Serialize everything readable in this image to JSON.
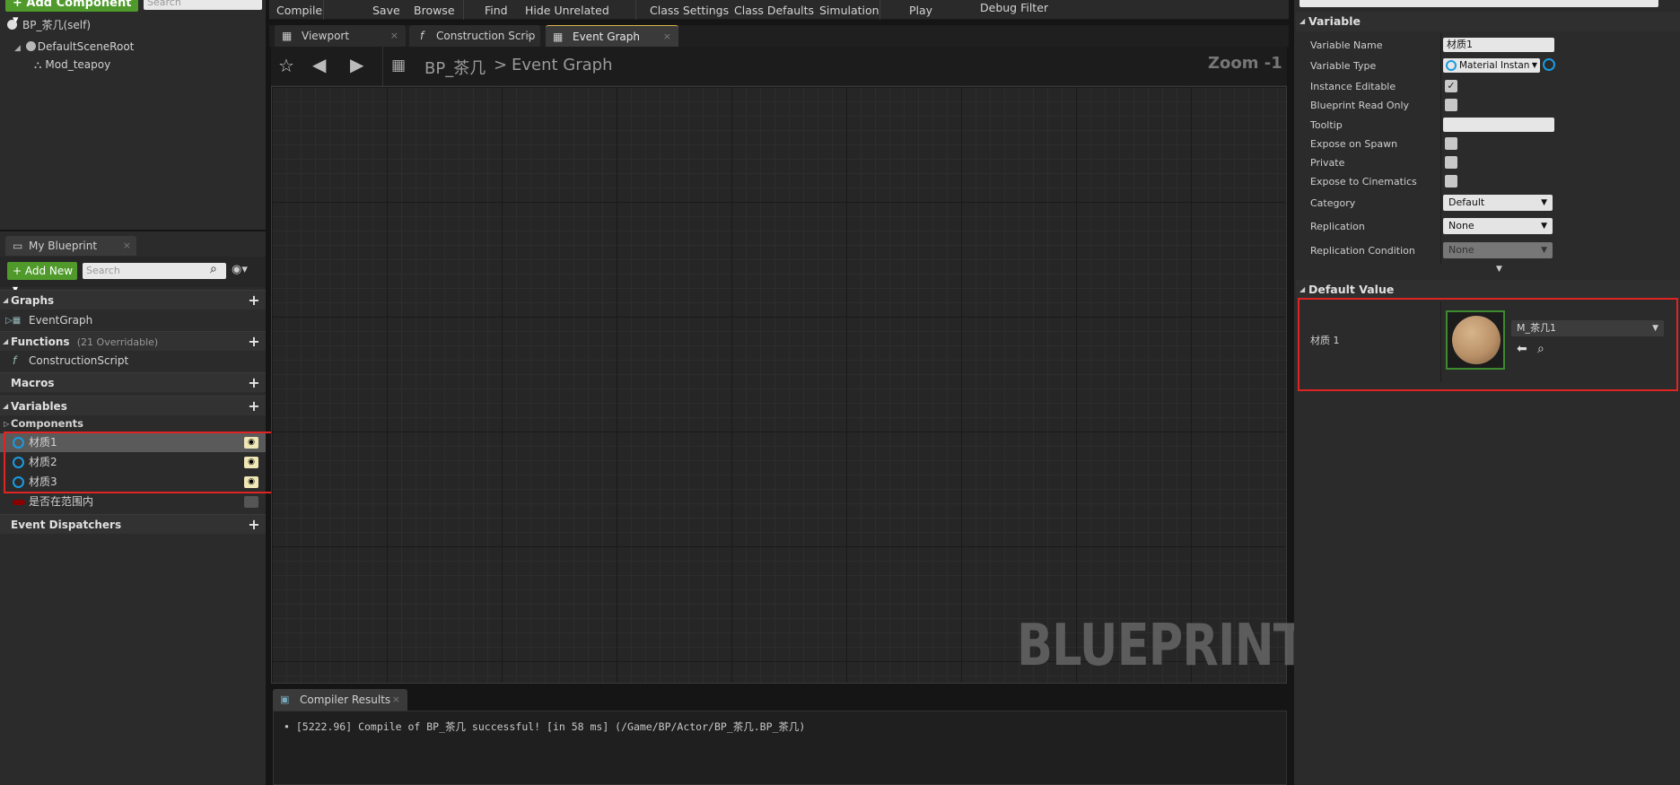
{
  "toolbar": {
    "compile": "Compile",
    "save": "Save",
    "browse": "Browse",
    "find": "Find",
    "hide_unrelated": "Hide Unrelated",
    "class_settings": "Class Settings",
    "class_defaults": "Class Defaults",
    "simulation": "Simulation",
    "play": "Play",
    "debug_filter": "Debug Filter"
  },
  "components": {
    "add_button": "+ Add Component ▾",
    "search_placeholder": "Search",
    "self": "BP_茶几(self)",
    "root": "DefaultSceneRoot",
    "mesh": "Mod_teapoy"
  },
  "my_blueprint": {
    "tab": "My Blueprint",
    "add_new": "+ Add New ▾",
    "search_placeholder": "Search",
    "graphs": "Graphs",
    "event_graph": "EventGraph",
    "functions": "Functions",
    "functions_count": "(21 Overridable)",
    "construction_script": "ConstructionScript",
    "macros": "Macros",
    "variables": "Variables",
    "components": "Components",
    "variable_items": [
      "材质1",
      "材质2",
      "材质3"
    ],
    "bool_var": "是否在范围内",
    "event_dispatchers": "Event Dispatchers"
  },
  "tabs": {
    "viewport": "Viewport",
    "construction": "Construction Scrip",
    "event_graph": "Event Graph"
  },
  "graph": {
    "breadcrumb_bp": "BP_茶几",
    "breadcrumb_sep": ">",
    "breadcrumb_graph": "Event Graph",
    "zoom": "Zoom -1",
    "watermark": "BLUEPRINT"
  },
  "compiler": {
    "tab": "Compiler Results",
    "message": "• [5222.96] Compile of BP_茶几 successful! [in 58 ms] (/Game/BP/Actor/BP_茶几.BP_茶几)"
  },
  "details": {
    "variable_section": "Variable",
    "variable_name_label": "Variable Name",
    "variable_name_value": "材质1",
    "variable_type_label": "Variable Type",
    "variable_type_value": "Material Instan",
    "instance_editable": "Instance Editable",
    "blueprint_read_only": "Blueprint Read Only",
    "tooltip": "Tooltip",
    "expose_on_spawn": "Expose on Spawn",
    "private": "Private",
    "expose_cinematics": "Expose to Cinematics",
    "category_label": "Category",
    "category_value": "Default",
    "replication_label": "Replication",
    "replication_value": "None",
    "replication_condition_label": "Replication Condition",
    "replication_condition_value": "None",
    "default_value_section": "Default Value",
    "default_label": "材质 1",
    "asset_value": "M_茶几1"
  },
  "colors": {
    "accent_green": "#4f9a2b",
    "highlight_red": "#e02323",
    "object_blue": "#1a9be0"
  }
}
